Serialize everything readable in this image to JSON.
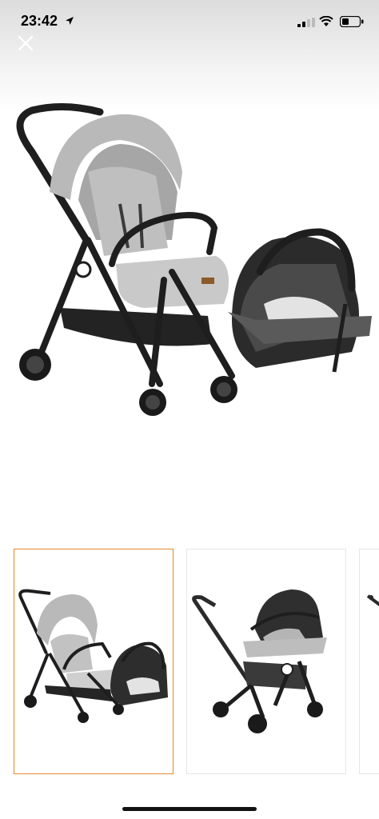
{
  "status_bar": {
    "time": "23:42",
    "icons": [
      "location-arrow-icon",
      "signal-icon",
      "wifi-icon",
      "battery-icon"
    ]
  },
  "viewer": {
    "close_icon": "close-icon",
    "main_image": "stroller-travel-system-image",
    "thumbnails": [
      {
        "image": "stroller-with-car-seat-thumbnail",
        "selected": true
      },
      {
        "image": "car-seat-on-stroller-frame-thumbnail",
        "selected": false
      },
      {
        "image": "partial-thumbnail",
        "selected": false
      }
    ]
  },
  "colors": {
    "thumbnail_selected_border": "#e38b2c",
    "fabric_gray": "#bdbdbd",
    "frame_black": "#1c1c1c"
  }
}
